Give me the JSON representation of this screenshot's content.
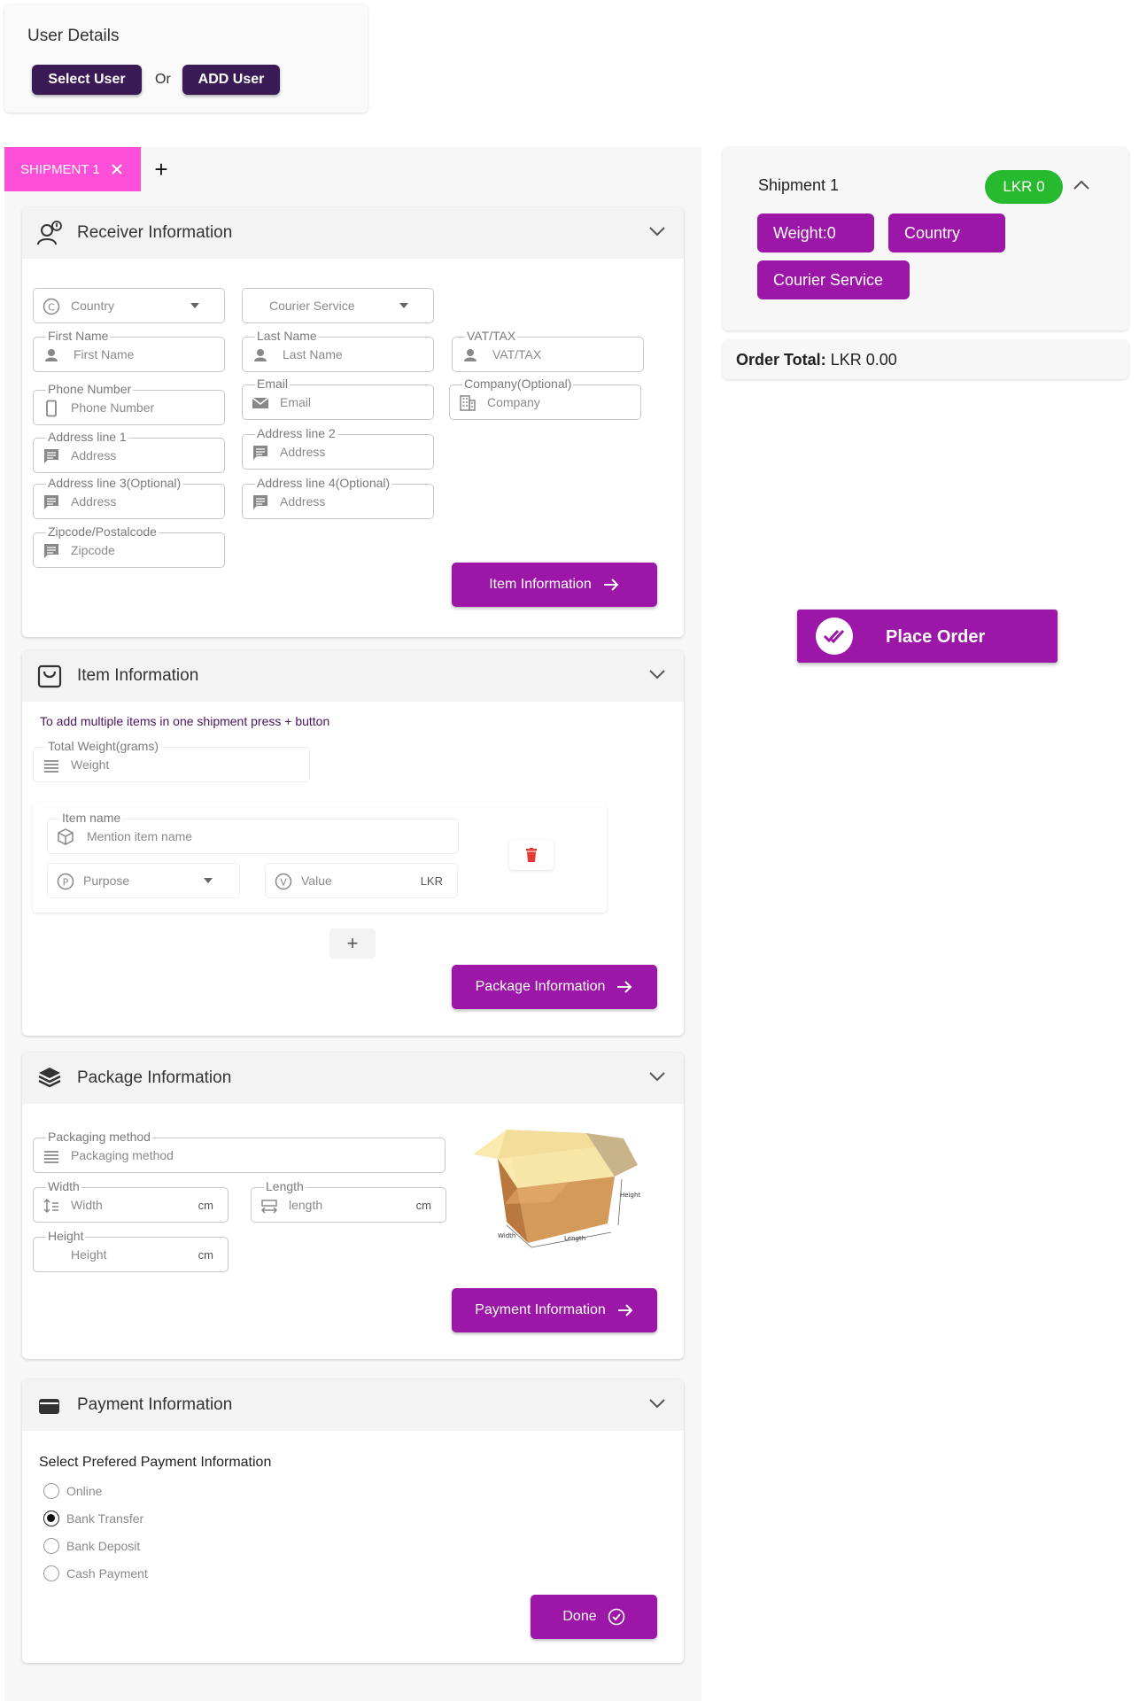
{
  "user_details": {
    "title": "User Details",
    "select_user": "Select User",
    "or": "Or",
    "add_user": "ADD User"
  },
  "tabs": {
    "active": "SHIPMENT 1",
    "add": "+"
  },
  "receiver": {
    "title": "Receiver Information",
    "country_ph": "Country",
    "courier_ph": "Courier Service",
    "first_name_label": "First Name",
    "first_name_ph": "First Name",
    "last_name_label": "Last Name",
    "last_name_ph": "Last Name",
    "vat_label": "VAT/TAX",
    "vat_ph": "VAT/TAX",
    "phone_label": "Phone Number",
    "phone_ph": "Phone Number",
    "email_label": "Email",
    "email_ph": "Email",
    "company_label": "Company(Optional)",
    "company_ph": "Company",
    "addr1_label": "Address line 1",
    "addr2_label": "Address line 2",
    "addr3_label": "Address line 3(Optional)",
    "addr4_label": "Address line 4(Optional)",
    "addr_ph": "Address",
    "zip_label": "Zipcode/Postalcode",
    "zip_ph": "Zipcode",
    "next_button": "Item Information"
  },
  "item": {
    "title": "Item Information",
    "hint": "To add multiple items in one shipment press + button",
    "weight_label": "Total Weight(grams)",
    "weight_ph": "Weight",
    "item_name_label": "Item name",
    "item_name_ph": "Mention item name",
    "purpose_ph": "Purpose",
    "value_ph": "Value",
    "value_unit": "LKR",
    "add_item": "+",
    "next_button": "Package Information"
  },
  "package": {
    "title": "Package Information",
    "method_label": "Packaging method",
    "method_ph": "Packaging method",
    "width_label": "Width",
    "width_ph": "Width",
    "length_label": "Length",
    "length_ph": "length",
    "height_label": "Height",
    "height_ph": "Height",
    "unit": "cm",
    "box_labels": {
      "height": "Height",
      "width": "Width",
      "length": "Length"
    },
    "next_button": "Payment  Information"
  },
  "payment": {
    "title": "Payment Information",
    "prompt": "Select Prefered Payment Information",
    "options": [
      "Online",
      "Bank Transfer",
      "Bank Deposit",
      "Cash Payment"
    ],
    "selected": "Bank Transfer",
    "done_button": "Done"
  },
  "summary": {
    "shipment_title": "Shipment 1",
    "price_badge": "LKR 0",
    "weight_chip": "Weight:0",
    "country_chip": "Country",
    "courier_chip": "Courier Service",
    "order_total_label": "Order Total:",
    "order_total_value": "LKR 0.00",
    "place_order": "Place Order"
  },
  "colors": {
    "primary": "#9c17a8",
    "dark": "#3b1b55",
    "tab_pink": "#ff4fd8",
    "badge_green": "#27b92e",
    "delete_red": "#e53935"
  }
}
